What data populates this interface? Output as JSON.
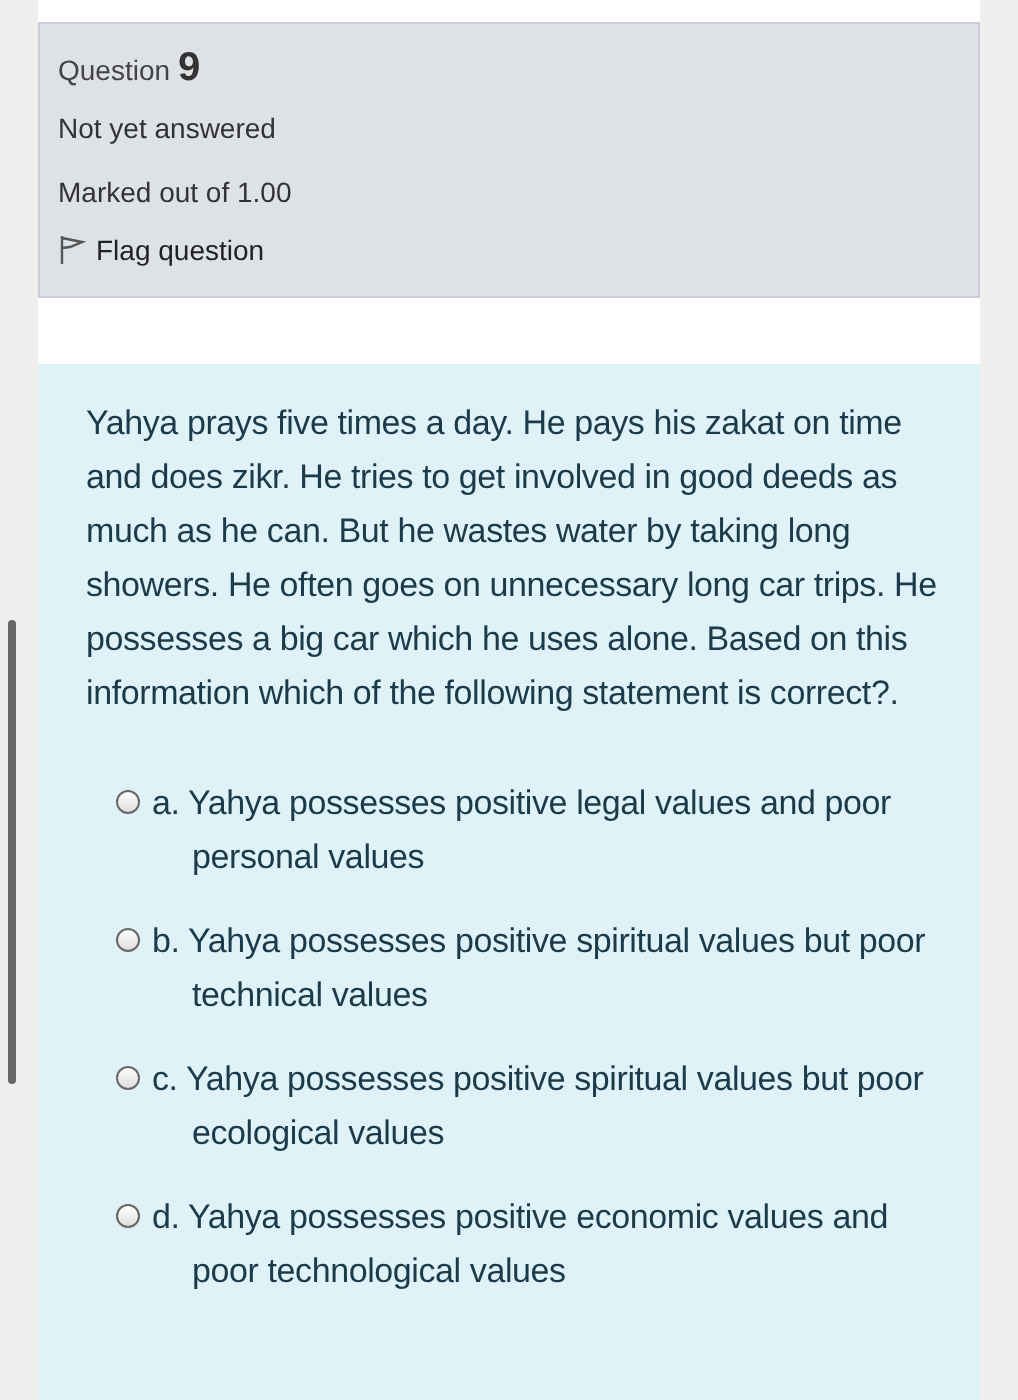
{
  "question_info": {
    "label": "Question",
    "number": "9",
    "status": "Not yet answered",
    "marks": "Marked out of 1.00",
    "flag": {
      "label": "Flag question",
      "flagged": false
    }
  },
  "question": {
    "text": "Yahya prays five times a day. He pays his zakat on time and does zikr. He tries to get involved in good deeds as much as he can. But he wastes water by taking long showers. He often goes on unnecessary long car trips. He possesses a big car which he uses alone. Based on this information which of the following statement is correct?.",
    "options": [
      {
        "text": "a. Yahya possesses positive legal values and poor personal values",
        "selected": false
      },
      {
        "text": "b. Yahya possesses positive spiritual values but poor technical values",
        "selected": false
      },
      {
        "text": "c. Yahya possesses positive spiritual values but poor ecological values",
        "selected": false
      },
      {
        "text": "d. Yahya possesses positive economic values and poor technological values",
        "selected": false
      }
    ]
  }
}
